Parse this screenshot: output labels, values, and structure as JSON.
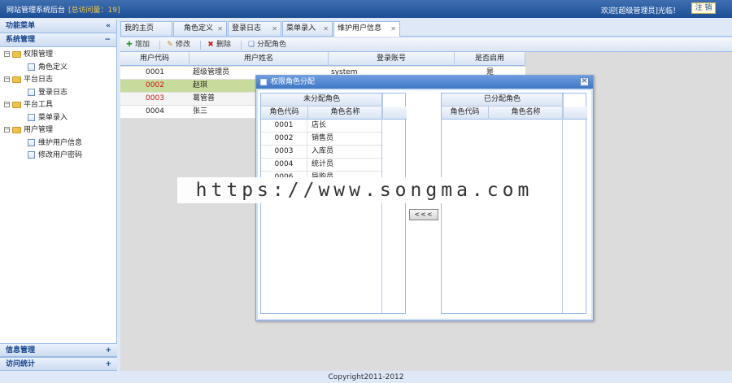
{
  "header": {
    "title": "网站管理系统后台",
    "visits": "[总访问量：19]",
    "welcome": "欢迎[超级管理员]光临！",
    "logout_label": "注 销"
  },
  "sidebar": {
    "title": "功能菜单",
    "collapse_glyph": "«",
    "section": {
      "label": "系统管理",
      "toggle": "−"
    },
    "tree": [
      {
        "label": "权限管理",
        "children": [
          "角色定义"
        ]
      },
      {
        "label": "平台日志",
        "children": [
          "登录日志"
        ]
      },
      {
        "label": "平台工具",
        "children": [
          "菜单录入"
        ]
      },
      {
        "label": "用户管理",
        "children": [
          "维护用户信息",
          "修改用户密码"
        ]
      }
    ],
    "bottom": [
      {
        "label": "信息管理",
        "toggle": "+"
      },
      {
        "label": "访问统计",
        "toggle": "+"
      }
    ]
  },
  "tabs": [
    {
      "label": "我的主页",
      "closable": false
    },
    {
      "label": "角色定义",
      "closable": true
    },
    {
      "label": "登录日志",
      "closable": true
    },
    {
      "label": "菜单录入",
      "closable": true
    },
    {
      "label": "维护用户信息",
      "closable": true
    }
  ],
  "toolbar": {
    "add": "增加",
    "edit": "修改",
    "delete": "删除",
    "assign": "分配角色"
  },
  "grid": {
    "headers": [
      "用户代码",
      "用户姓名",
      "登录账号",
      "是否启用"
    ],
    "rows": [
      {
        "code": "0001",
        "name": "超级管理员",
        "account": "system",
        "enabled": "是"
      },
      {
        "code": "0002",
        "name": "赵琪",
        "account": "",
        "enabled": ""
      },
      {
        "code": "0003",
        "name": "葛管普",
        "account": "",
        "enabled": ""
      },
      {
        "code": "0004",
        "name": "张三",
        "account": "",
        "enabled": ""
      }
    ]
  },
  "dialog": {
    "title": "权限角色分配",
    "close": "✕",
    "unassigned": {
      "title": "未分配角色",
      "headers": [
        "角色代码",
        "角色名称"
      ],
      "rows": [
        {
          "code": "0001",
          "name": "店长"
        },
        {
          "code": "0002",
          "name": "销售员"
        },
        {
          "code": "0003",
          "name": "入库员"
        },
        {
          "code": "0004",
          "name": "统计员"
        },
        {
          "code": "0006",
          "name": "导购员"
        }
      ]
    },
    "assigned": {
      "title": "已分配角色",
      "headers": [
        "角色代码",
        "角色名称"
      ]
    },
    "move_button": "<<<"
  },
  "watermark": "https://www.songma.com",
  "footer": "Copyright2011-2012"
}
